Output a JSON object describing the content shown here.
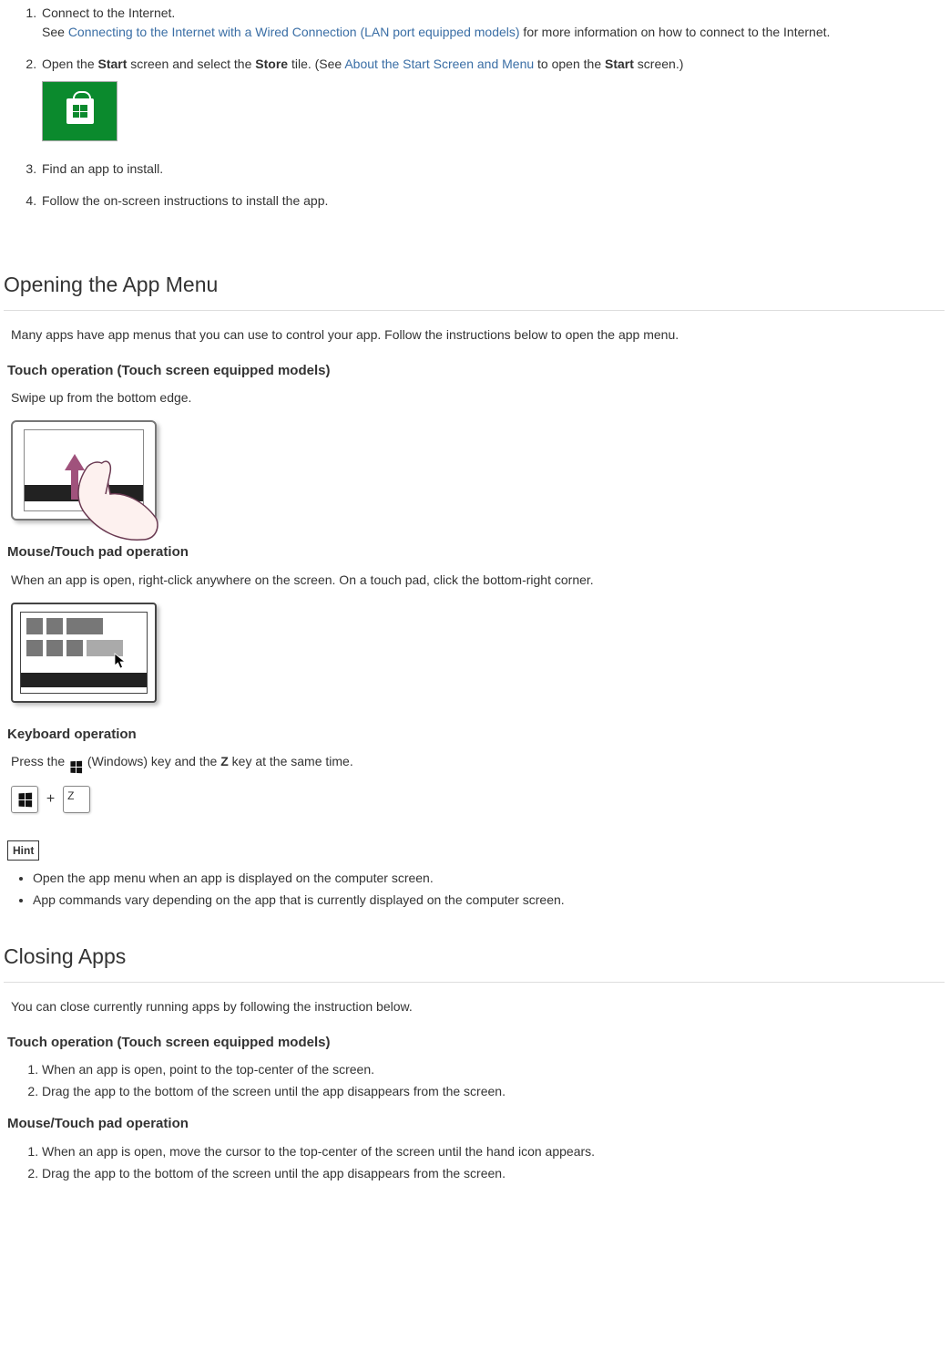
{
  "install": {
    "step1": {
      "title": "Connect to the Internet.",
      "see": "See ",
      "link": "Connecting to the Internet with a Wired Connection (LAN port equipped models)",
      "after": " for more information on how to connect to the Internet."
    },
    "step2": {
      "pre": "Open the ",
      "start": "Start",
      "mid1": " screen and select the ",
      "store": "Store",
      "mid2": " tile. (See ",
      "link": "About the Start Screen and Menu",
      "mid3": " to open the ",
      "start2": "Start",
      "after": " screen.)"
    },
    "step3": "Find an app to install.",
    "step4": "Follow the on-screen instructions to install the app."
  },
  "section_open": {
    "heading": "Opening the App Menu",
    "intro": "Many apps have app menus that you can use to control your app. Follow the instructions below to open the app menu.",
    "touch_head": "Touch operation (Touch screen equipped models)",
    "touch_text": "Swipe up from the bottom edge.",
    "mouse_head": "Mouse/Touch pad operation",
    "mouse_text": "When an app is open, right-click anywhere on the screen. On a touch pad, click the bottom-right corner.",
    "kb_head": "Keyboard operation",
    "kb": {
      "pre": "Press the ",
      "win": " (Windows) key and the ",
      "z": "Z",
      "after": " key at the same time."
    },
    "key_z": "Z",
    "hint_label": "Hint",
    "hints": [
      "Open the app menu when an app is displayed on the computer screen.",
      "App commands vary depending on the app that is currently displayed on the computer screen."
    ]
  },
  "section_close": {
    "heading": "Closing Apps",
    "intro": "You can close currently running apps by following the instruction below.",
    "touch_head": "Touch operation (Touch screen equipped models)",
    "touch_steps": [
      "When an app is open, point to the top-center of the screen.",
      "Drag the app to the bottom of the screen until the app disappears from the screen."
    ],
    "mouse_head": "Mouse/Touch pad operation",
    "mouse_steps": [
      "When an app is open, move the cursor to the top-center of the screen until the hand icon appears.",
      "Drag the app to the bottom of the screen until the app disappears from the screen."
    ]
  }
}
